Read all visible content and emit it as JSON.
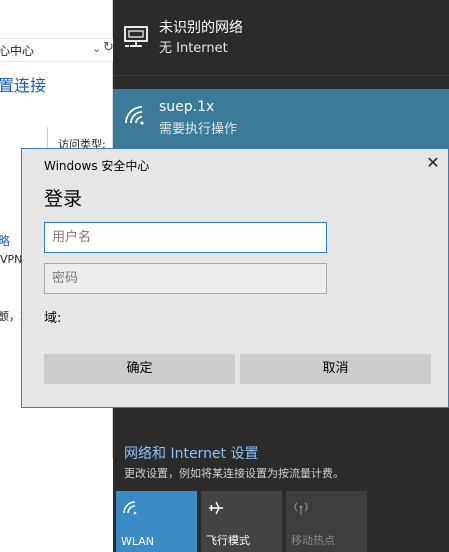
{
  "background_window": {
    "address_text": "心中心",
    "link_big": "置连接",
    "small_label": "访问类型:",
    "link_a": "略",
    "text_b": "VPN",
    "text_c": "颤，或"
  },
  "flyout": {
    "networks": [
      {
        "name": "未识别的网络",
        "status": "无 Internet",
        "icon": "wired-network-icon"
      },
      {
        "name": "suep.1x",
        "status": "需要执行操作",
        "icon": "wifi-icon"
      }
    ],
    "settings_link": "网络和 Internet 设置",
    "settings_desc": "更改设置，例如将某连接设置为按流量计费。",
    "quick_actions": [
      {
        "label": "WLAN",
        "icon": "wifi-icon",
        "active": true
      },
      {
        "label": "飞行模式",
        "icon": "airplane-icon",
        "active": false
      },
      {
        "label": "移动热点",
        "icon": "hotspot-icon",
        "active": false
      }
    ]
  },
  "dialog": {
    "title": "Windows 安全中心",
    "heading": "登录",
    "username_placeholder": "用户名",
    "password_placeholder": "密码",
    "domain_label": "域:",
    "ok_label": "确定",
    "cancel_label": "取消",
    "close_glyph": "✕"
  },
  "colors": {
    "flyout_bg": "#2b2b2b",
    "selected_network_bg": "#3b7a98",
    "wlan_tile_bg": "#3a8cc6",
    "link_color": "#8cc3ff",
    "dialog_border": "#3f7db0"
  }
}
